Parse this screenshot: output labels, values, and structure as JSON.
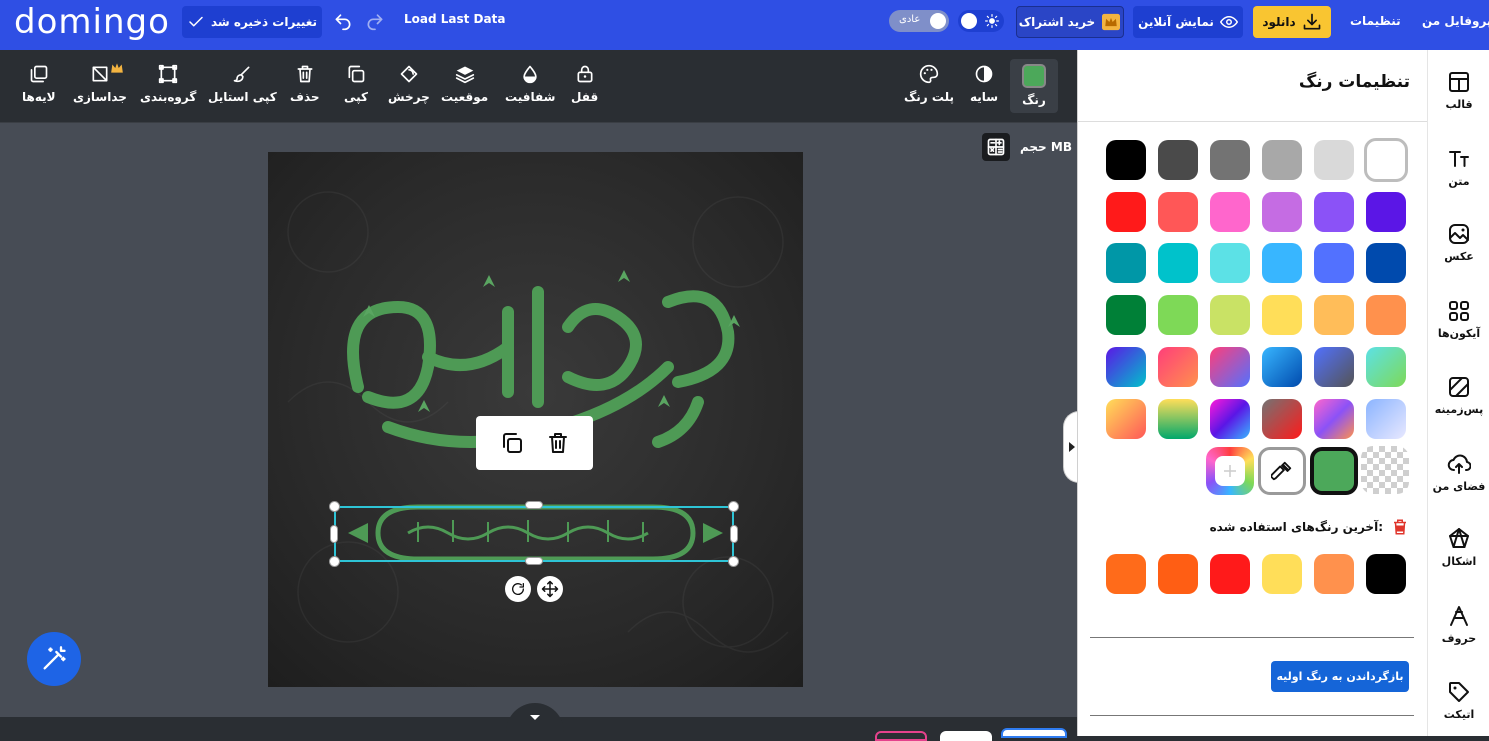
{
  "topbar": {
    "logo": "domingo",
    "save_status": "تغییرات ذخیره شد",
    "load_last": "Load Last Data",
    "mode_badge": "عادی",
    "subscribe": "خرید اشتراک",
    "preview": "نمایش آنلاین",
    "download": "دانلود",
    "settings": "تنظیمات",
    "profile": "پروفایل من"
  },
  "toolbar": {
    "layers": "لایه‌ها",
    "separate": "جداسازی",
    "group": "گروه‌بندی",
    "copy_style": "کپی استایل",
    "delete": "حذف",
    "copy": "کپی",
    "rotate": "چرخش",
    "position": "موقعیت",
    "opacity": "شفافیت",
    "lock": "قفل",
    "palette": "پلت رنگ",
    "shadow": "سایه",
    "color": "رنگ",
    "current_color": "#4ca85a"
  },
  "canvas": {
    "size_label": "حجم MB"
  },
  "panel": {
    "title": "تنظیمات رنگ",
    "swatches_row1": [
      "#ffffff",
      "#d9d9d9",
      "#a8a8a8",
      "#737373",
      "#4a4a4a",
      "#000000"
    ],
    "swatches_row2": [
      "#5b16e6",
      "#8b52f7",
      "#c56ce3",
      "#ff66cc",
      "#ff5757",
      "#ff1a1a"
    ],
    "swatches_row3": [
      "#004aad",
      "#5271ff",
      "#38b6ff",
      "#5ce1e6",
      "#00c2cb",
      "#0097a7"
    ],
    "swatches_row4": [
      "#ff914d",
      "#ffbd59",
      "#ffde59",
      "#c9e265",
      "#7ed957",
      "#008037"
    ],
    "recent_label": "آخرین رنگ‌های استفاده شده:",
    "recent_colors": [
      "#000000",
      "#ff914d",
      "#ffde59",
      "#ff1a1a",
      "#ff5e14",
      "#ff6b1a"
    ],
    "reset_button": "بازگرداندن به رنگ اولیه"
  },
  "rightnav": {
    "template": "قالب",
    "text": "متن",
    "photo": "عکس",
    "icons": "آیکون‌ها",
    "background": "پس‌زمینه",
    "my_space": "فضای من",
    "shapes": "اشکال",
    "letters": "حروف",
    "sticker": "اتیکت"
  }
}
